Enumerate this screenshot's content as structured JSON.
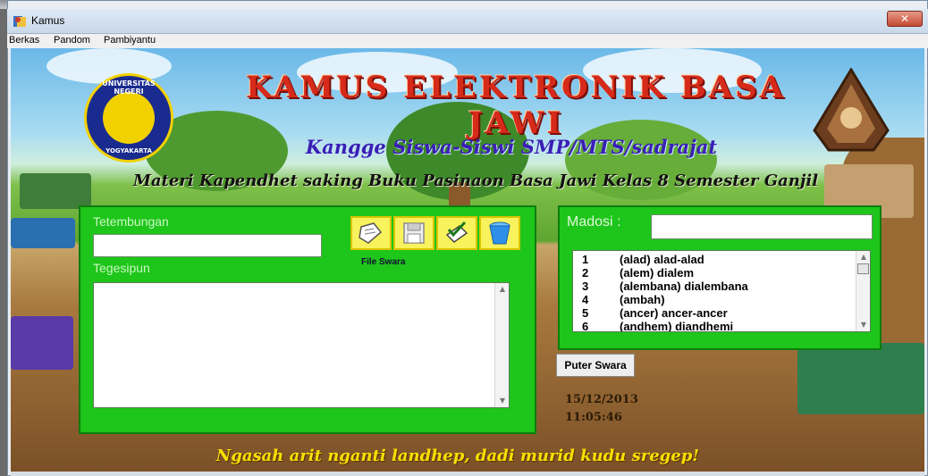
{
  "window": {
    "title": "Kamus",
    "close_glyph": "✕"
  },
  "menu": [
    "Berkas",
    "Pandom",
    "Pambiyantu"
  ],
  "header": {
    "title": "KAMUS ELEKTRONIK BASA JAWI",
    "subtitle": "Kangge Siswa-Siswi SMP/MTS/sadrajat",
    "subtitle2": "Materi Kapendhet saking Buku Pasinaon Basa Jawi Kelas 8 Semester Ganjil",
    "logo_text_top": "UNIVERSITAS NEGERI",
    "logo_text_bottom": "YOGYAKARTA"
  },
  "left_panel": {
    "tetembungan_label": "Tetembungan",
    "tetembungan_value": "",
    "tegesipun_label": "Tegesipun",
    "tegesipun_value": "",
    "file_swara_label": "File Swara",
    "buttons": [
      "file-open-icon",
      "save-icon",
      "check-edit-icon",
      "bucket-icon"
    ]
  },
  "right_panel": {
    "madosi_label": "Madosi :",
    "madosi_value": "",
    "list": [
      {
        "num": "1",
        "word": "(alad) alad-alad"
      },
      {
        "num": "2",
        "word": "(alem) dialem"
      },
      {
        "num": "3",
        "word": "(alembana) dialembana"
      },
      {
        "num": "4",
        "word": "(ambah)"
      },
      {
        "num": "5",
        "word": "(ancer) ancer-ancer"
      },
      {
        "num": "6",
        "word": "(andhem) diandhemi"
      }
    ]
  },
  "puter_swara_label": "Puter Swara",
  "date": "15/12/2013",
  "time": "11:05:46",
  "footer": "Ngasah arit nganti landhep, dadi murid kudu sregep!",
  "colors": {
    "panel_green": "#1ec51a",
    "tool_yellow": "#f8f25c",
    "heading_red": "#d62a1a",
    "subtitle_blue": "#3a1fb5",
    "footer_yellow": "#f7e000"
  }
}
